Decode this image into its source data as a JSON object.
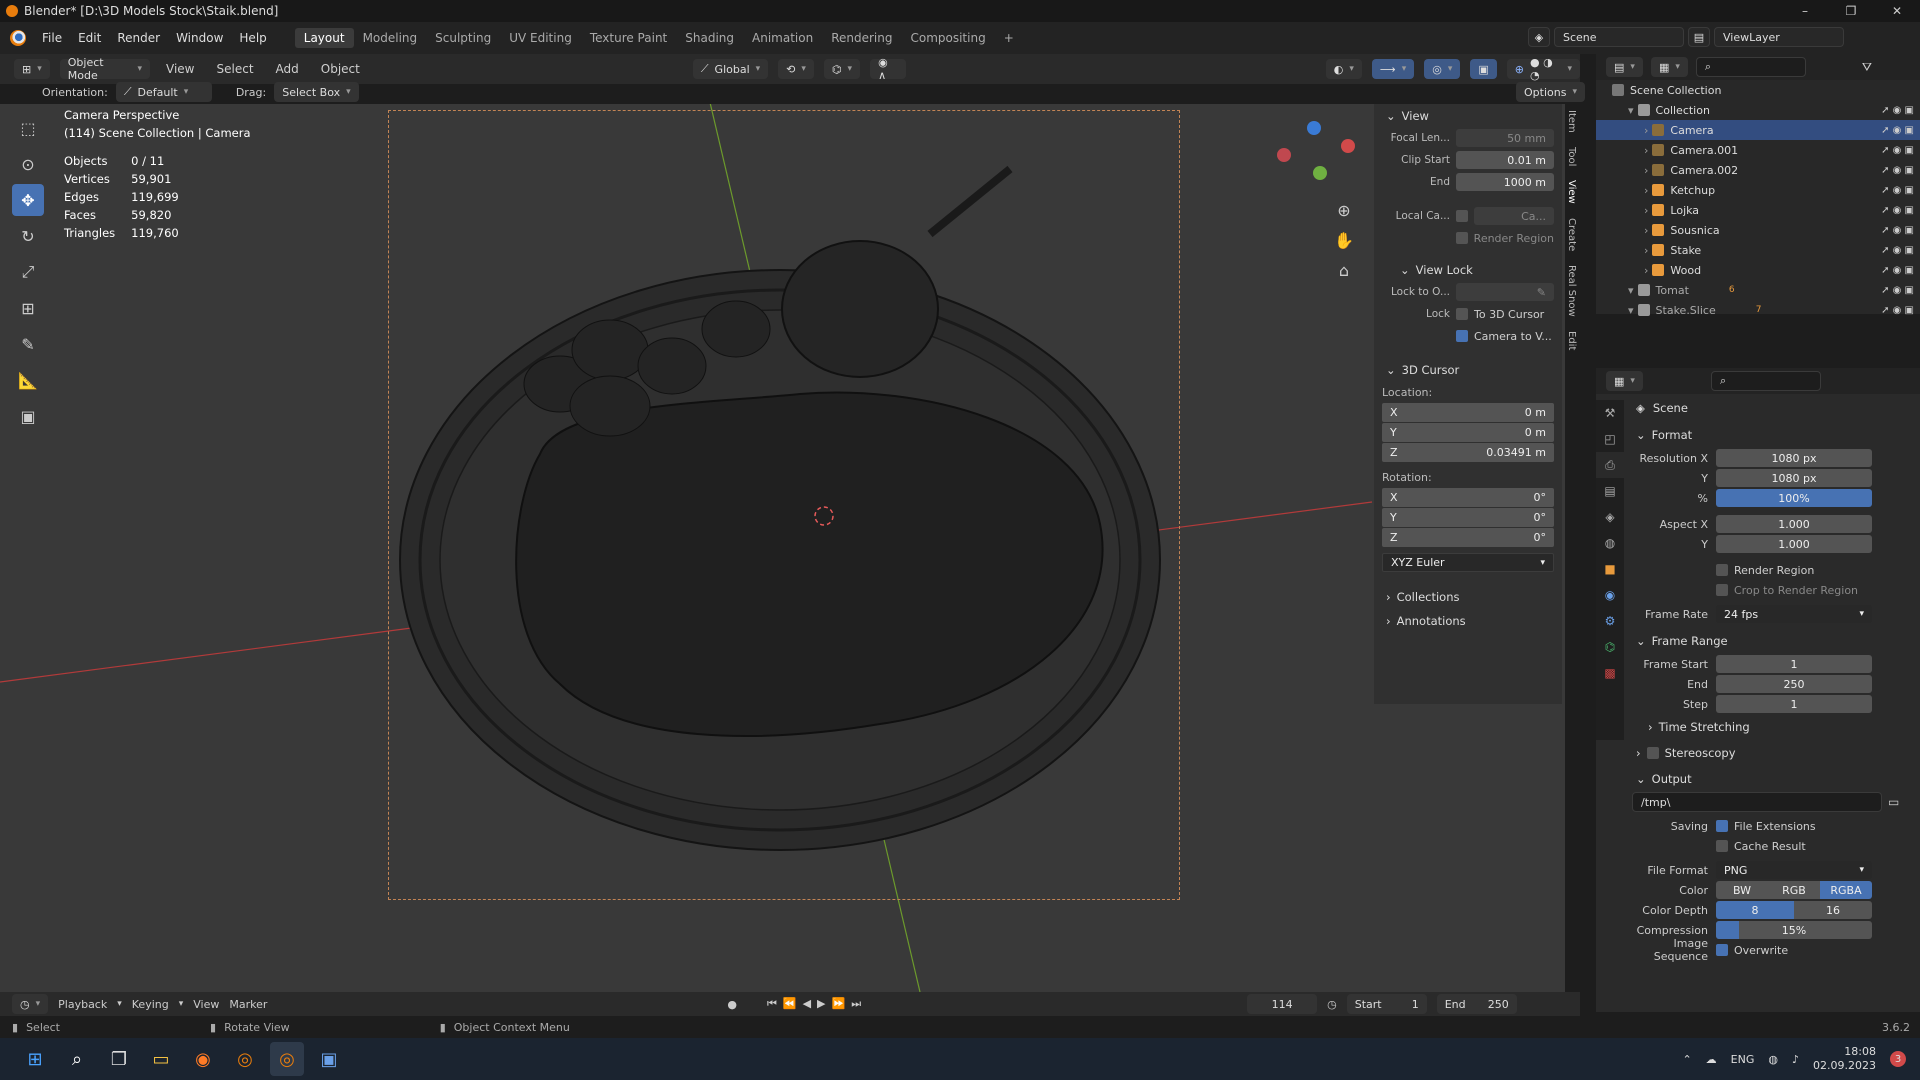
{
  "window": {
    "title": "Blender* [D:\\3D Models Stock\\Staik.blend]",
    "controls": [
      "–",
      "❐",
      "✕"
    ]
  },
  "menu": [
    "File",
    "Edit",
    "Render",
    "Window",
    "Help"
  ],
  "workspaces": [
    "Layout",
    "Modeling",
    "Sculpting",
    "UV Editing",
    "Texture Paint",
    "Shading",
    "Animation",
    "Rendering",
    "Compositing"
  ],
  "active_workspace": "Layout",
  "scene_selector": {
    "scene": "Scene",
    "view_layer": "ViewLayer"
  },
  "header3d": {
    "mode": "Object Mode",
    "menus": [
      "View",
      "Select",
      "Add",
      "Object"
    ],
    "transform_orientation": "Global",
    "options": "Options"
  },
  "tool_settings": {
    "orientation_label": "Orientation:",
    "orientation": "Default",
    "drag_label": "Drag:",
    "drag": "Select Box"
  },
  "overlay_text": {
    "line1": "Camera Perspective",
    "line2": "(114) Scene Collection | Camera"
  },
  "stats": [
    {
      "label": "Objects",
      "value": "0 / 11"
    },
    {
      "label": "Vertices",
      "value": "59,901"
    },
    {
      "label": "Edges",
      "value": "119,699"
    },
    {
      "label": "Faces",
      "value": "59,820"
    },
    {
      "label": "Triangles",
      "value": "119,760"
    }
  ],
  "npanel": {
    "view_title": "View",
    "focal_label": "Focal Len...",
    "focal_value": "50 mm",
    "clip_start_label": "Clip Start",
    "clip_start_value": "0.01 m",
    "clip_end_label": "End",
    "clip_end_value": "1000 m",
    "local_cam_label": "Local Ca...",
    "local_cam_value": "Ca...",
    "render_region": "Render Region",
    "view_lock_title": "View Lock",
    "lock_obj_label": "Lock to O...",
    "lock_label": "Lock",
    "to_3d_cursor": "To 3D Cursor",
    "camera_to_view": "Camera to V...",
    "cursor_title": "3D Cursor",
    "location_label": "Location:",
    "loc": [
      {
        "axis": "X",
        "value": "0 m"
      },
      {
        "axis": "Y",
        "value": "0 m"
      },
      {
        "axis": "Z",
        "value": "0.03491 m"
      }
    ],
    "rotation_label": "Rotation:",
    "rot": [
      {
        "axis": "X",
        "value": "0°"
      },
      {
        "axis": "Y",
        "value": "0°"
      },
      {
        "axis": "Z",
        "value": "0°"
      }
    ],
    "rotation_mode": "XYZ Euler",
    "collections_title": "Collections",
    "annotations_title": "Annotations",
    "tabs": [
      "Item",
      "Tool",
      "View",
      "Create",
      "Real Snow",
      "Edit"
    ]
  },
  "outliner": {
    "search_placeholder": "",
    "root": "Scene Collection",
    "items": [
      {
        "name": "Collection",
        "level": 1,
        "type": "collection"
      },
      {
        "name": "Camera",
        "level": 2,
        "type": "camera",
        "selected": true
      },
      {
        "name": "Camera.001",
        "level": 2,
        "type": "camera"
      },
      {
        "name": "Camera.002",
        "level": 2,
        "type": "camera"
      },
      {
        "name": "Ketchup",
        "level": 2,
        "type": "mesh"
      },
      {
        "name": "Lojka",
        "level": 2,
        "type": "mesh"
      },
      {
        "name": "Sousnica",
        "level": 2,
        "type": "mesh"
      },
      {
        "name": "Stake",
        "level": 2,
        "type": "mesh"
      },
      {
        "name": "Wood",
        "level": 2,
        "type": "mesh"
      },
      {
        "name": "Tomat",
        "level": 1,
        "type": "collection",
        "badge": "6"
      },
      {
        "name": "Stake.Slice",
        "level": 1,
        "type": "collection",
        "badge": "7"
      }
    ]
  },
  "properties": {
    "context": "Scene",
    "format_title": "Format",
    "res_x_label": "Resolution X",
    "res_x": "1080 px",
    "res_y_label": "Y",
    "res_y": "1080 px",
    "res_pct_label": "%",
    "res_pct": "100%",
    "aspect_x_label": "Aspect X",
    "aspect_x": "1.000",
    "aspect_y_label": "Y",
    "aspect_y": "1.000",
    "render_region": "Render Region",
    "crop_region": "Crop to Render Region",
    "frame_rate_label": "Frame Rate",
    "frame_rate": "24 fps",
    "frame_range_title": "Frame Range",
    "frame_start_label": "Frame Start",
    "frame_start": "1",
    "frame_end_label": "End",
    "frame_end": "250",
    "step_label": "Step",
    "step": "1",
    "time_stretching": "Time Stretching",
    "stereoscopy": "Stereoscopy",
    "output_title": "Output",
    "output_path": "/tmp\\",
    "saving_label": "Saving",
    "file_ext": "File Extensions",
    "cache_result": "Cache Result",
    "file_format_label": "File Format",
    "file_format": "PNG",
    "color_label": "Color",
    "color_opts": [
      "BW",
      "RGB",
      "RGBA"
    ],
    "depth_label": "Color Depth",
    "depth_opts": [
      "8",
      "16"
    ],
    "compression_label": "Compression",
    "compression": "15%",
    "image_seq_label": "Image Sequence",
    "overwrite": "Overwrite"
  },
  "timeline": {
    "menus": [
      "Playback",
      "Keying",
      "View",
      "Marker"
    ],
    "current_frame": "114",
    "start_label": "Start",
    "start": "1",
    "end_label": "End",
    "end": "250"
  },
  "statusbar": {
    "select": "Select",
    "rotate": "Rotate View",
    "context": "Object Context Menu",
    "version": "3.6.2"
  },
  "taskbar": {
    "lang": "ENG",
    "time": "18:08",
    "date": "02.09.2023",
    "notif": "3"
  },
  "colors": {
    "accent": "#4772b3",
    "selection": "#334d80",
    "camera_frame": "#c28455",
    "x_axis": "#d14a4a",
    "y_axis": "#7fb13b"
  }
}
